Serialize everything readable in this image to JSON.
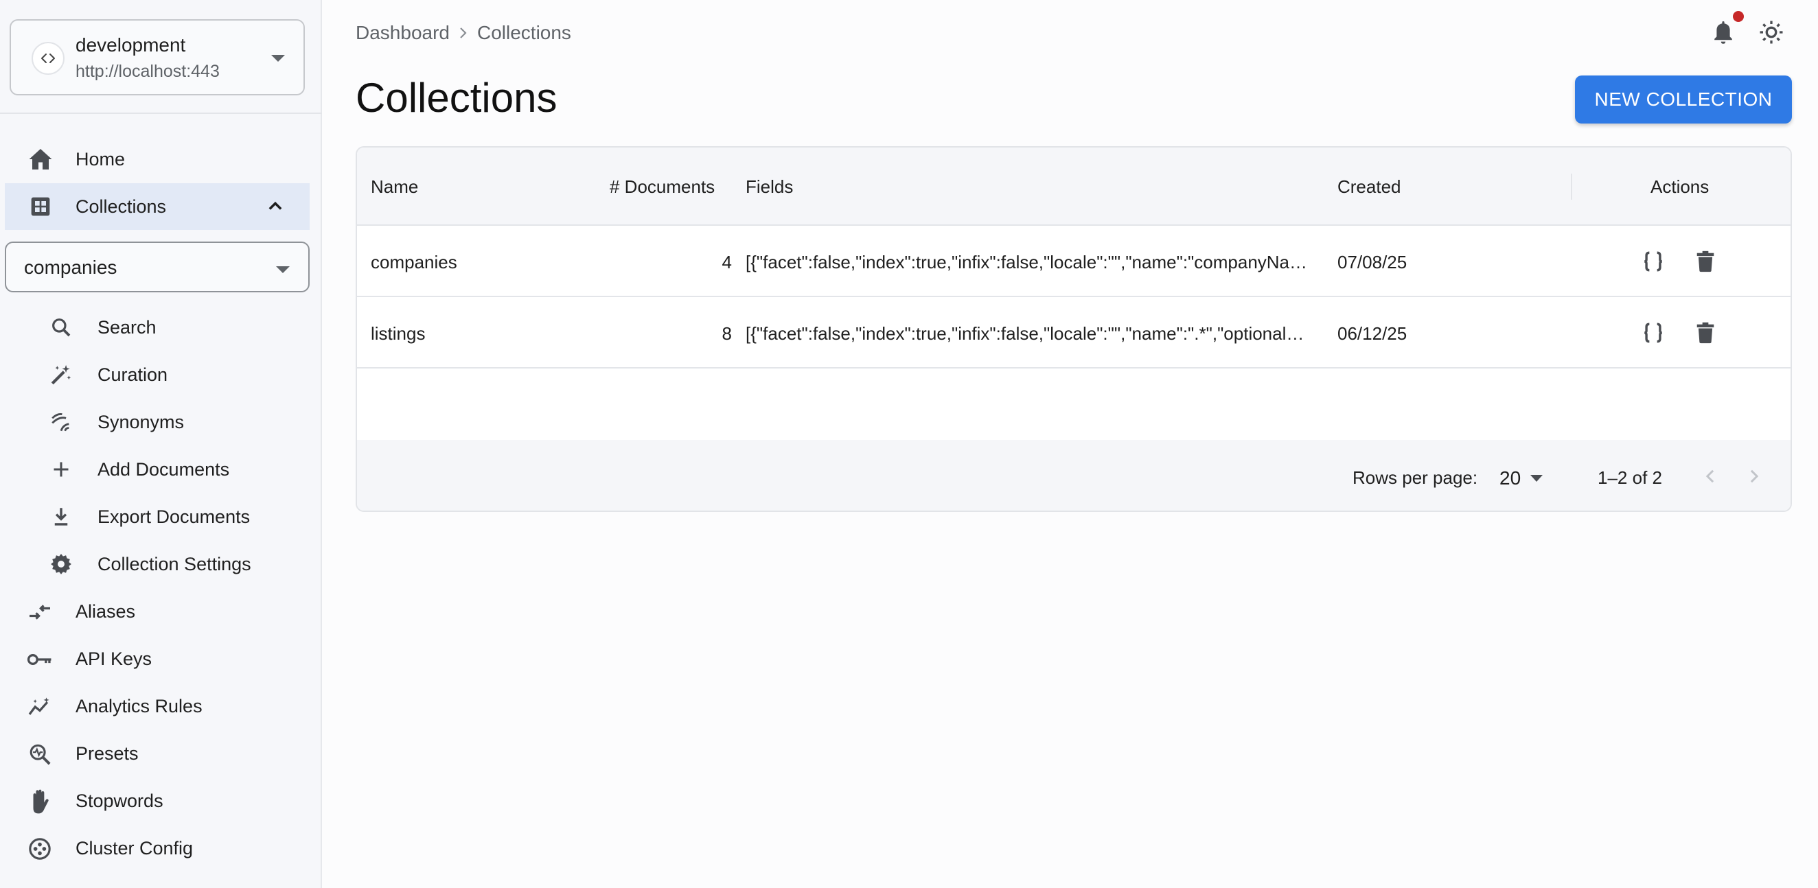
{
  "server": {
    "name": "development",
    "url": "http://localhost:443"
  },
  "nav": {
    "home": "Home",
    "collections": "Collections"
  },
  "collection_select": {
    "value": "companies"
  },
  "collection_menu": {
    "search": "Search",
    "curation": "Curation",
    "synonyms": "Synonyms",
    "add_documents": "Add Documents",
    "export_documents": "Export Documents",
    "collection_settings": "Collection Settings"
  },
  "lower_nav": {
    "aliases": "Aliases",
    "api_keys": "API Keys",
    "analytics_rules": "Analytics Rules",
    "presets": "Presets",
    "stopwords": "Stopwords",
    "cluster_config": "Cluster Config"
  },
  "breadcrumb": {
    "root": "Dashboard",
    "current": "Collections"
  },
  "page": {
    "title": "Collections",
    "new_button": "NEW COLLECTION"
  },
  "table": {
    "headers": {
      "name": "Name",
      "documents": "# Documents",
      "fields": "Fields",
      "created": "Created",
      "actions": "Actions"
    },
    "rows": [
      {
        "name": "companies",
        "documents": "4",
        "fields": "[{\"facet\":false,\"index\":true,\"infix\":false,\"locale\":\"\",\"name\":\"companyNa…",
        "created": "07/08/25"
      },
      {
        "name": "listings",
        "documents": "8",
        "fields": "[{\"facet\":false,\"index\":true,\"infix\":false,\"locale\":\"\",\"name\":\".*\",\"optional\"…",
        "created": "06/12/25"
      }
    ],
    "footer": {
      "rows_per_page_label": "Rows per page:",
      "rows_per_page": "20",
      "range": "1–2 of 2"
    }
  },
  "colors": {
    "accent": "#2f7ae5",
    "active_nav_bg": "#e2e9f6",
    "notification_dot": "#c62828"
  }
}
